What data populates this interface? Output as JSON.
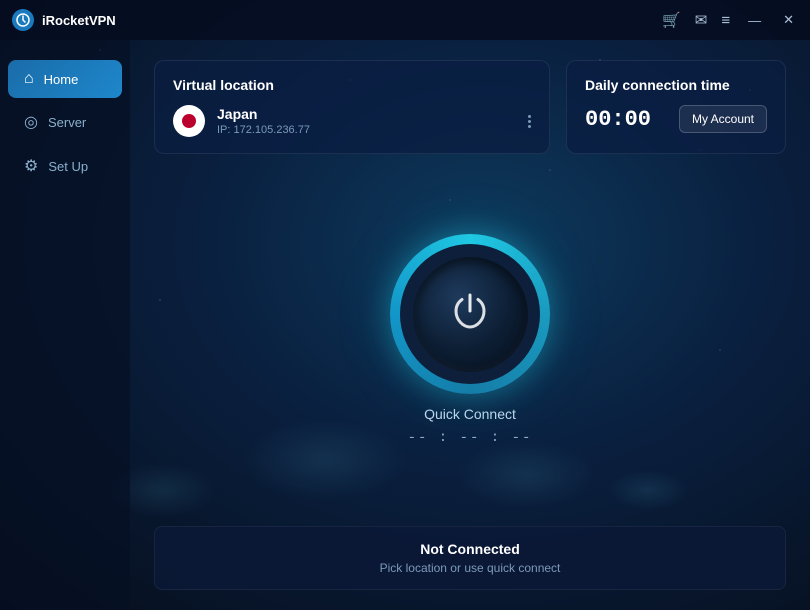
{
  "app": {
    "title": "iRocketVPN"
  },
  "titlebar": {
    "cart_icon": "🛒",
    "mail_icon": "✉",
    "menu_icon": "≡",
    "minimize_icon": "—",
    "close_icon": "✕"
  },
  "sidebar": {
    "items": [
      {
        "id": "home",
        "label": "Home",
        "icon": "⌂",
        "active": true
      },
      {
        "id": "server",
        "label": "Server",
        "icon": "◎",
        "active": false
      },
      {
        "id": "setup",
        "label": "Set Up",
        "icon": "⚙",
        "active": false
      }
    ]
  },
  "virtual_location": {
    "card_title": "Virtual location",
    "country": "Japan",
    "ip_label": "IP: 172.105.236.77"
  },
  "connection_time": {
    "card_title": "Daily connection time",
    "time": "00:00",
    "account_button": "My Account"
  },
  "power_button": {
    "label": "Quick Connect",
    "timer": "-- : -- : --"
  },
  "status": {
    "title": "Not Connected",
    "subtitle": "Pick location or use quick connect"
  }
}
